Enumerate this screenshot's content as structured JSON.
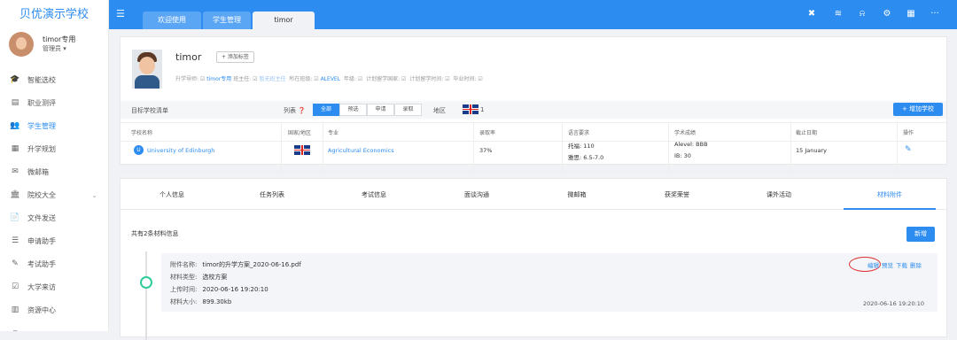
{
  "sidebar": {
    "logo": "贝优演示学校",
    "user_name": "timor专用",
    "user_role": "管理员 ▾",
    "items": [
      {
        "label": "智能选校",
        "icon": "graduation-cap-icon",
        "glyph": "🎓"
      },
      {
        "label": "职业测评",
        "icon": "clipboard-icon",
        "glyph": "▤"
      },
      {
        "label": "学生管理",
        "icon": "users-icon",
        "glyph": "👥"
      },
      {
        "label": "升学规划",
        "icon": "list-icon",
        "glyph": "▦"
      },
      {
        "label": "微邮箱",
        "icon": "mail-icon",
        "glyph": "✉"
      },
      {
        "label": "院校大全",
        "icon": "bank-icon",
        "glyph": "🏛"
      },
      {
        "label": "文件发送",
        "icon": "file-icon",
        "glyph": "📄"
      },
      {
        "label": "申请助手",
        "icon": "list-bullet-icon",
        "glyph": "☰"
      },
      {
        "label": "考试助手",
        "icon": "edit-icon",
        "glyph": "✎"
      },
      {
        "label": "大学来访",
        "icon": "calendar-check-icon",
        "glyph": "☑"
      },
      {
        "label": "资源中心",
        "icon": "archive-icon",
        "glyph": "▥"
      },
      {
        "label": "",
        "icon": "more-icon",
        "glyph": "▪"
      }
    ]
  },
  "topbar": {
    "tabs": [
      "欢迎使用",
      "学生管理",
      "timor"
    ],
    "icons": [
      {
        "name": "close-circle-icon",
        "glyph": "✖"
      },
      {
        "name": "wifi-icon",
        "glyph": "≋"
      },
      {
        "name": "bell-icon",
        "glyph": "⍾"
      },
      {
        "name": "gear-icon",
        "glyph": "⚙"
      },
      {
        "name": "calendar-icon",
        "glyph": "▦"
      },
      {
        "name": "more-icon",
        "glyph": "···"
      }
    ]
  },
  "student": {
    "name": "timor",
    "add_tag": "+ 添加标签",
    "advisor_label": "升学导师:",
    "advisor": "timor专用",
    "class_teacher_label": "班主任:",
    "class_teacher": "暂无班主任",
    "class_label": "所在班级:",
    "class": "ALEVEL",
    "grade_label": "年级:",
    "country_label": "计划留学国家:",
    "time_label": "计划留学时间:",
    "graduation_label": "毕业时间:"
  },
  "school_list": {
    "title": "目标学校清单",
    "list_label": "列表 ❓",
    "filters": [
      "全部",
      "预选",
      "申请",
      "录取"
    ],
    "region_label": "地区",
    "region_count": "1",
    "add_button": "+ 增加学校",
    "columns": [
      "学校名称",
      "国家/地区",
      "专业",
      "录取率",
      "语言要求",
      "学术成绩",
      "截止日期",
      "操作"
    ],
    "rows": [
      {
        "school": "University of Edinburgh",
        "major": "Agricultural Economics",
        "rate": "37%",
        "lang1": "托福: 110",
        "lang2": "雅思: 6.5-7.0",
        "acad1": "Alevel: BBB",
        "acad2": "IB: 30",
        "deadline": "15 January"
      }
    ]
  },
  "detail_tabs": [
    "个人信息",
    "任务列表",
    "考试信息",
    "面谈沟通",
    "微邮箱",
    "获奖荣誉",
    "课外活动",
    "材料附件"
  ],
  "attachments": {
    "count_text": "共有2条材料信息",
    "new_button": "新增",
    "item": {
      "name_label": "附件名称:",
      "name": "timor的升学方案_2020-06-16.pdf",
      "type_label": "材料类型:",
      "type": "选校方案",
      "time_label": "上传时间:",
      "time": "2020-06-16 19:20:10",
      "size_label": "材料大小:",
      "size": "899.30kb",
      "ops": [
        "编辑",
        "预览",
        "下载",
        "删除"
      ],
      "date": "2020-06-16 19:20:10"
    }
  }
}
